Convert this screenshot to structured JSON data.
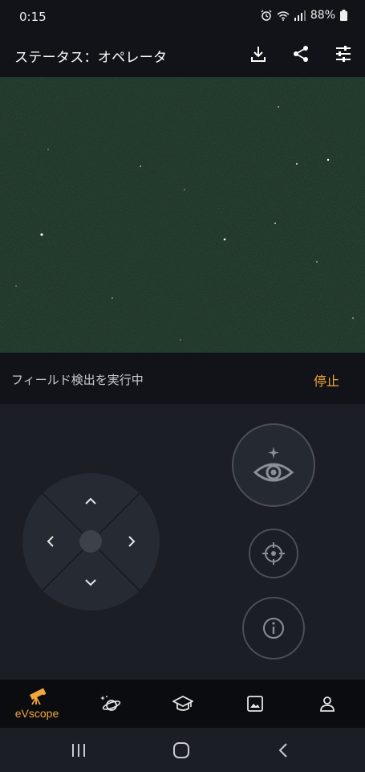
{
  "status_bar": {
    "time": "0:15",
    "battery": "88%",
    "icons": [
      "alarm-icon",
      "wifi-icon",
      "signal-icon",
      "battery-icon"
    ]
  },
  "header": {
    "title": "ステータス：オペレータ",
    "actions": [
      "download-icon",
      "share-icon",
      "settings-sliders-icon"
    ]
  },
  "status_strip": {
    "message": "フィールド検出を実行中",
    "action_label": "停止"
  },
  "controls": {
    "dpad": [
      "up-arrow-icon",
      "down-arrow-icon",
      "left-arrow-icon",
      "right-arrow-icon"
    ],
    "buttons": [
      "observe-eye-icon",
      "target-crosshair-icon",
      "info-icon"
    ]
  },
  "bottom_nav": {
    "active_label": "eVscope",
    "items": [
      "telescope-icon",
      "planet-icon",
      "graduation-cap-icon",
      "image-icon",
      "user-icon"
    ]
  },
  "colors": {
    "accent": "#f2a73b",
    "background": "#1b1e24",
    "header": "#111318",
    "sky": "#0f2418"
  }
}
